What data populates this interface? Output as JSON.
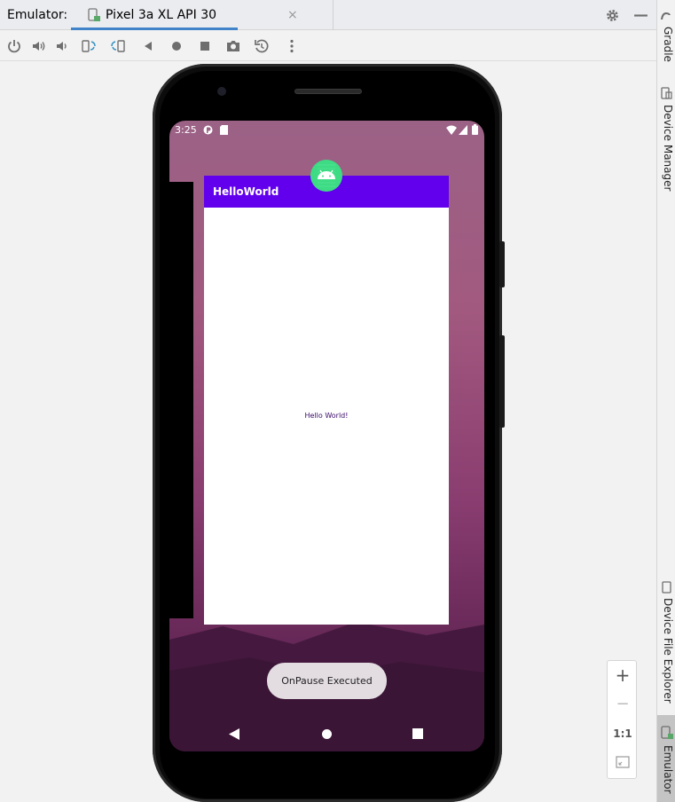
{
  "window": {
    "tool_title": "Emulator:",
    "tab_label": "Pixel 3a XL API 30",
    "tab_close": "×"
  },
  "toolbar": {
    "icons": [
      "power-icon",
      "volume-up-icon",
      "volume-down-icon",
      "rotate-left-icon",
      "rotate-right-icon",
      "back-icon",
      "home-icon",
      "overview-icon",
      "screenshot-icon",
      "snapshot-icon",
      "more-icon"
    ]
  },
  "right_strip": {
    "items": [
      "Gradle",
      "Device Manager",
      "Device File Explorer",
      "Emulator"
    ]
  },
  "zoom": {
    "zoom_in": "+",
    "zoom_out": "−",
    "actual_size": "1:1"
  },
  "device": {
    "status_time": "3:25",
    "app_title": "HelloWorld",
    "content_text": "Hello World!",
    "toast_text": "OnPause Executed"
  },
  "colors": {
    "app_bar": "#6200ee",
    "tab_underline": "#4083c9",
    "toast_bg": "#e3dde2"
  }
}
